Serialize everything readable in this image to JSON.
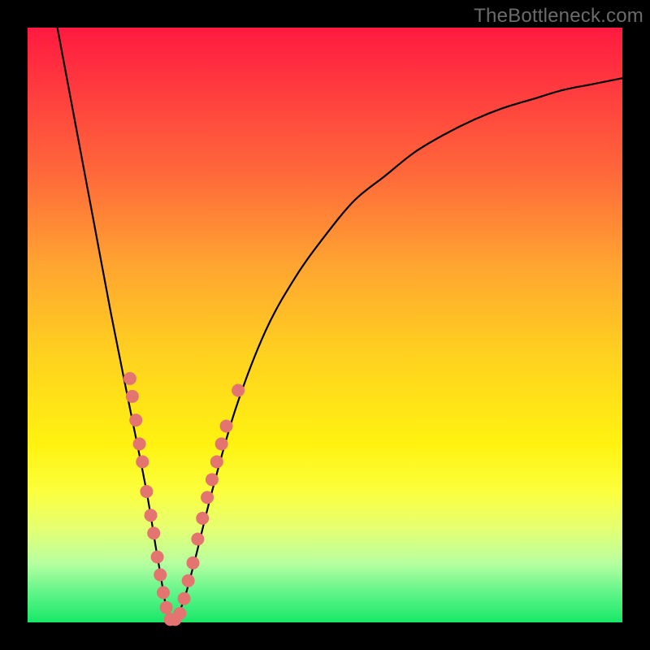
{
  "watermark": "TheBottleneck.com",
  "colors": {
    "frame": "#000000",
    "curve": "#000000",
    "dots": "#e4746f",
    "gradient_top": "#ff1a40",
    "gradient_bottom": "#18e867"
  },
  "chart_data": {
    "type": "line",
    "title": "",
    "xlabel": "",
    "ylabel": "",
    "xlim": [
      0,
      100
    ],
    "ylim": [
      0,
      100
    ],
    "x_minimum": 24,
    "minimum_value": 0,
    "series": [
      {
        "name": "bottleneck-curve",
        "x": [
          5,
          8,
          11,
          14,
          17,
          20,
          22,
          24,
          26,
          28,
          31,
          35,
          40,
          45,
          50,
          55,
          60,
          65,
          70,
          75,
          80,
          85,
          90,
          95,
          100
        ],
        "y": [
          100,
          84,
          68,
          52,
          37,
          22,
          10,
          0,
          3,
          10,
          22,
          36,
          49,
          58,
          65,
          71,
          75,
          79,
          82,
          84.5,
          86.5,
          88,
          89.5,
          90.5,
          91.5
        ]
      }
    ],
    "dots": [
      {
        "x": 17.2,
        "y": 41
      },
      {
        "x": 17.6,
        "y": 38
      },
      {
        "x": 18.2,
        "y": 34
      },
      {
        "x": 18.8,
        "y": 30
      },
      {
        "x": 19.3,
        "y": 27
      },
      {
        "x": 20.0,
        "y": 22
      },
      {
        "x": 20.7,
        "y": 18
      },
      {
        "x": 21.2,
        "y": 15
      },
      {
        "x": 21.8,
        "y": 11
      },
      {
        "x": 22.3,
        "y": 8
      },
      {
        "x": 22.8,
        "y": 5
      },
      {
        "x": 23.3,
        "y": 2.5
      },
      {
        "x": 24.0,
        "y": 0.5
      },
      {
        "x": 24.8,
        "y": 0.5
      },
      {
        "x": 25.6,
        "y": 1.5
      },
      {
        "x": 26.3,
        "y": 4
      },
      {
        "x": 27.0,
        "y": 7
      },
      {
        "x": 27.8,
        "y": 10
      },
      {
        "x": 28.6,
        "y": 14
      },
      {
        "x": 29.4,
        "y": 17.5
      },
      {
        "x": 30.2,
        "y": 21
      },
      {
        "x": 31.0,
        "y": 24
      },
      {
        "x": 31.8,
        "y": 27
      },
      {
        "x": 32.6,
        "y": 30
      },
      {
        "x": 33.4,
        "y": 33
      },
      {
        "x": 35.4,
        "y": 39
      }
    ]
  }
}
